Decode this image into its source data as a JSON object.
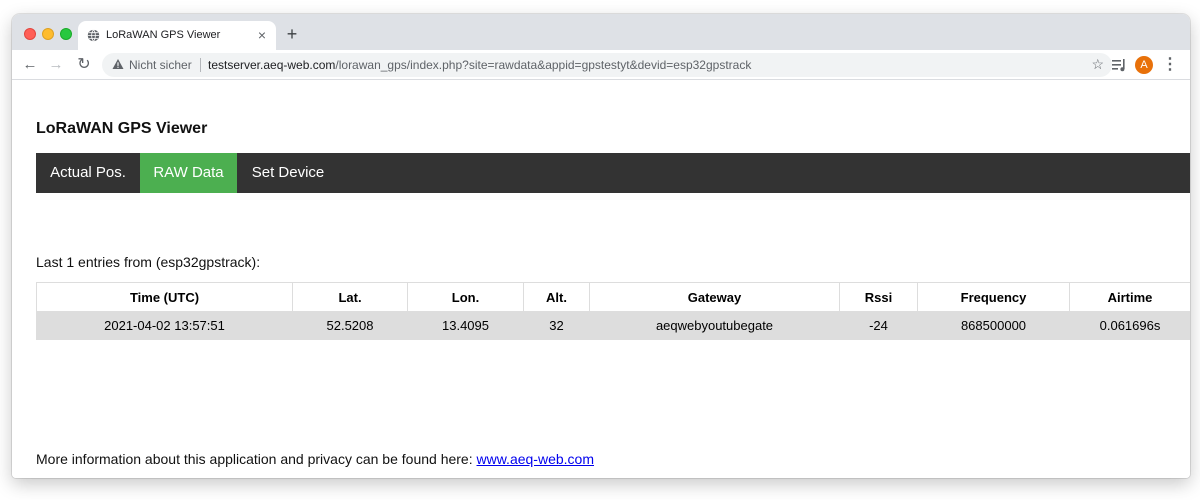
{
  "browser": {
    "tab": {
      "title": "LoRaWAN GPS Viewer",
      "close": "×"
    },
    "new_tab": "+",
    "nav": {
      "back": "←",
      "forward": "→",
      "reload": "↻"
    },
    "address": {
      "security_label": "Nicht sicher",
      "host": "testserver.aeq-web.com",
      "path": "/lorawan_gps/index.php?site=rawdata&appid=gpstestyt&devid=esp32gpstrack"
    },
    "bookmark_icon": "☆",
    "avatar_initial": "A",
    "menu_icon": "⋮"
  },
  "page": {
    "title": "LoRaWAN GPS Viewer",
    "nav_items": [
      {
        "label": "Actual Pos.",
        "active": false
      },
      {
        "label": "RAW Data",
        "active": true
      },
      {
        "label": "Set Device",
        "active": false
      }
    ],
    "active_color": "#4caf50",
    "navbar_color": "#333333",
    "entries_label": "Last 1 entries from (esp32gpstrack):",
    "table": {
      "headers": [
        "Time (UTC)",
        "Lat.",
        "Lon.",
        "Alt.",
        "Gateway",
        "Rssi",
        "Frequency",
        "Airtime"
      ],
      "rows": [
        [
          "2021-04-02 13:57:51",
          "52.5208",
          "13.4095",
          "32",
          "aeqwebyoutubegate",
          "-24",
          "868500000",
          "0.061696s"
        ]
      ]
    },
    "footer": {
      "text": "More information about this application and privacy can be found here: ",
      "link_text": "www.aeq-web.com"
    }
  }
}
